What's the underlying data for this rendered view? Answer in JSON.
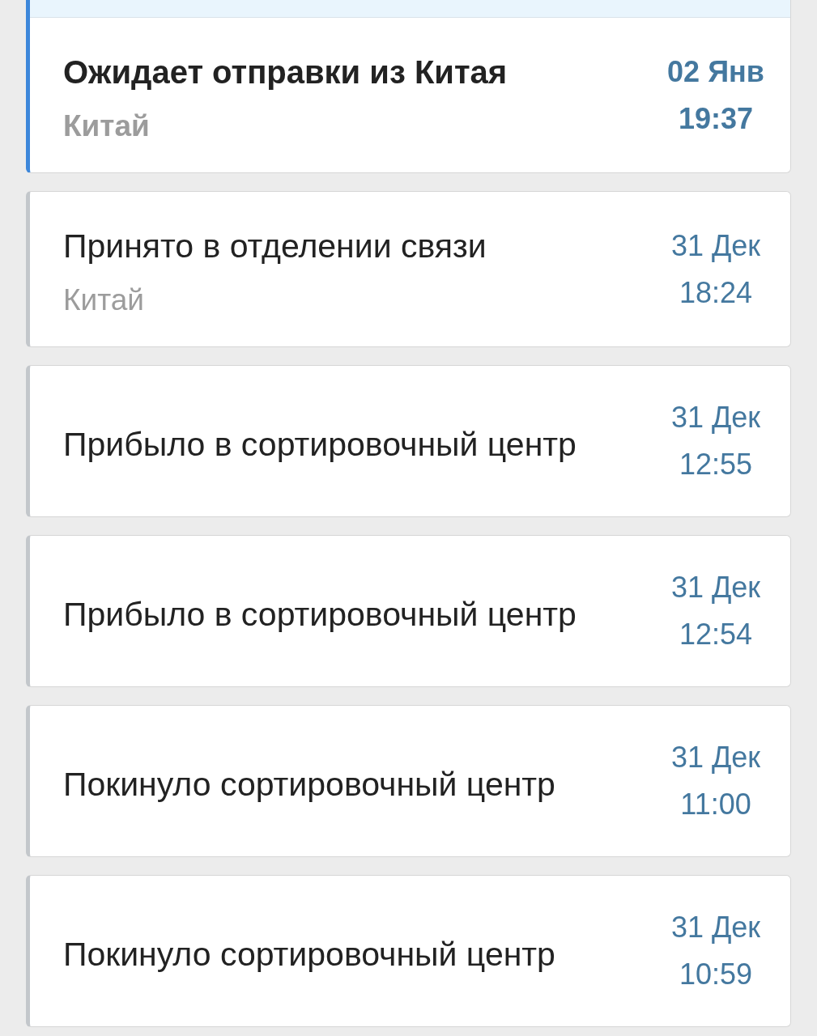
{
  "events": [
    {
      "title": "Ожидает отправки из Китая",
      "location": "Китай",
      "date": "02 Янв",
      "time": "19:37",
      "selected": true
    },
    {
      "title": "Принято в отделении связи",
      "location": "Китай",
      "date": "31 Дек",
      "time": "18:24",
      "selected": false
    },
    {
      "title": "Прибыло в сортировочный центр",
      "date": "31 Дек",
      "time": "12:55",
      "selected": false
    },
    {
      "title": "Прибыло в сортировочный центр",
      "date": "31 Дек",
      "time": "12:54",
      "selected": false
    },
    {
      "title": "Покинуло сортировочный центр",
      "date": "31 Дек",
      "time": "11:00",
      "selected": false
    },
    {
      "title": "Покинуло сортировочный центр",
      "date": "31 Дек",
      "time": "10:59",
      "selected": false
    }
  ]
}
